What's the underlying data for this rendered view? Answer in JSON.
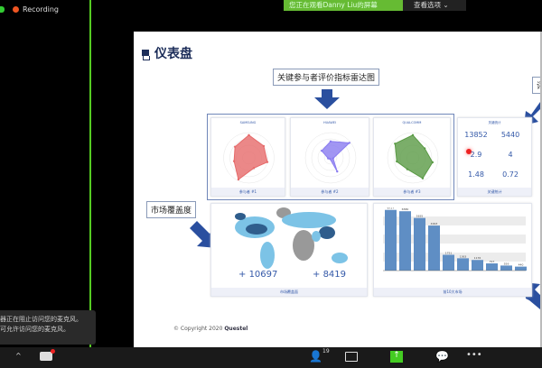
{
  "zoom": {
    "recording_label": "Recording",
    "viewing_banner": "您正在观看Danny Liu的屏幕",
    "view_options": "查看选项",
    "participants_count": "19",
    "toast_lines": [
      "器正在阻止访问您的麦克风。",
      "可允许访问您的麦克风。"
    ],
    "icons": [
      "shield-icon",
      "record-dot-icon",
      "chevron-down-icon",
      "participants-icon",
      "share-screen-icon",
      "chat-icon",
      "more-icon",
      "video-icon",
      "chevron-up-icon"
    ]
  },
  "slide": {
    "title": "仪表盘",
    "radar_label": "关键参与者评价指标雷达图",
    "market_label": "市场覆盖度",
    "right_label": "评",
    "copyright": "© Copyright 2020",
    "logo": "Questel",
    "colors": {
      "accent": "#2a4f9f",
      "samsung": "#e66a6a",
      "huawei": "#8a7cf0",
      "qualcomm": "#5a9a45"
    },
    "radars": [
      {
        "title": "SAMSUNG",
        "footer": "参与者 #1",
        "color": "#e66a6a",
        "values": [
          0.9,
          0.75,
          0.75,
          0.45,
          0.95,
          0.6,
          0.7
        ]
      },
      {
        "title": "HUAWEI",
        "footer": "参与者 #2",
        "color": "#8a7cf0",
        "values": [
          0.65,
          0.95,
          0.1,
          0.6,
          0.05,
          0.1,
          0.45
        ]
      },
      {
        "title": "QUALCOMM",
        "footer": "参与者 #3",
        "color": "#5a9a45",
        "values": [
          0.9,
          0.6,
          0.8,
          0.9,
          0.5,
          0.65,
          0.9
        ]
      }
    ],
    "stats": {
      "title": "关键统计",
      "footer": "关键统计",
      "items": [
        {
          "value": "13852"
        },
        {
          "value": "5440"
        },
        {
          "value": "2.9"
        },
        {
          "value": "4"
        },
        {
          "value": "1.48"
        },
        {
          "value": "0.72"
        }
      ]
    },
    "map": {
      "footer": "市场覆盖面",
      "stat1": "10697",
      "stat2": "8419"
    },
    "bars": {
      "footer": "前10大市场",
      "values": [
        6727,
        6580,
        5835,
        4993,
        1751,
        1363,
        1176,
        797,
        559,
        440
      ]
    }
  }
}
